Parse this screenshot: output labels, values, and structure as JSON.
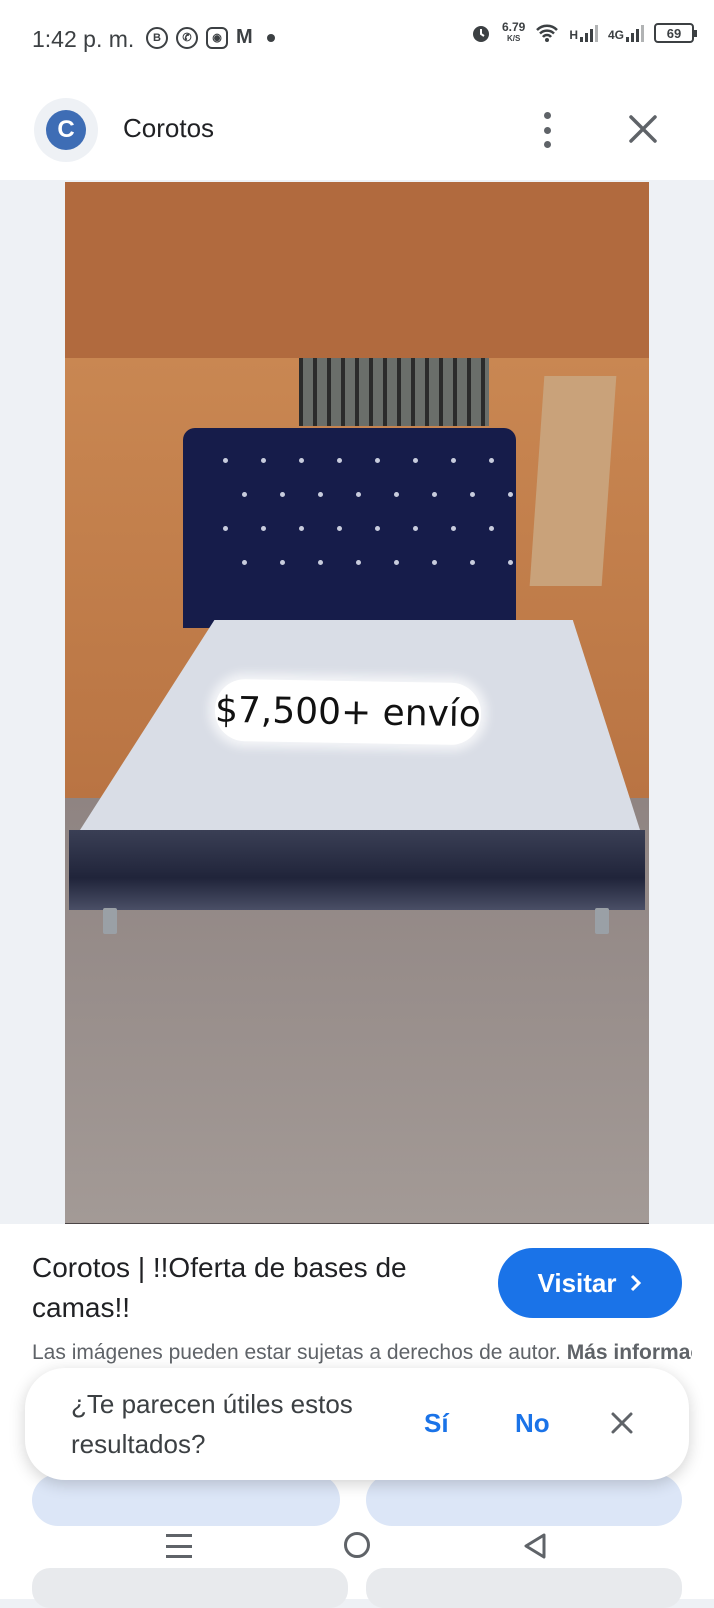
{
  "status_bar": {
    "time": "1:42 p. m.",
    "app_icons": [
      "B",
      "whatsapp-icon",
      "instagram-icon",
      "gmail-icon"
    ],
    "net_speed": "6.79",
    "net_speed_unit": "K/S",
    "signal_1_label": "H",
    "signal_2_label": "4G",
    "battery": "69"
  },
  "header": {
    "logo_letter": "C",
    "site_name": "Corotos"
  },
  "image": {
    "price_overlay": "$7,500+ envío",
    "accent_colors": {
      "wall": "#b16a3e",
      "headboard": "#161c4a"
    }
  },
  "result": {
    "title": "Corotos | !!Oferta de bases de camas!!",
    "visit_label": "Visitar",
    "disclaimer": "Las imágenes pueden estar sujetas a derechos de autor.",
    "more_info": "Más información"
  },
  "feedback": {
    "question": "¿Te parecen útiles estos resultados?",
    "yes": "Sí",
    "no": "No"
  },
  "colors": {
    "accent": "#1a73e8",
    "text": "#202124",
    "muted": "#5f6368"
  }
}
